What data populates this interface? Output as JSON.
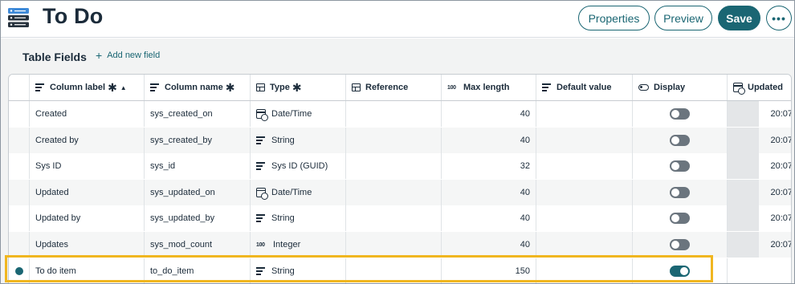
{
  "header": {
    "title": "To Do",
    "buttons": {
      "properties": "Properties",
      "preview": "Preview",
      "save": "Save",
      "more": "•••"
    }
  },
  "section": {
    "title": "Table Fields",
    "add_new": "Add new field"
  },
  "table": {
    "columns": {
      "label": "Column label",
      "name": "Column name",
      "type": "Type",
      "reference": "Reference",
      "max_length": "Max length",
      "default_value": "Default value",
      "display": "Display",
      "updated": "Updated"
    },
    "required_mark": "✱",
    "rows": [
      {
        "label": "Created",
        "name": "sys_created_on",
        "type": "Date/Time",
        "type_icon": "calendar-clock-icon",
        "max_length": "40",
        "display": false,
        "updated": "20:07"
      },
      {
        "label": "Created by",
        "name": "sys_created_by",
        "type": "String",
        "type_icon": "text-lines-icon",
        "max_length": "40",
        "display": false,
        "updated": "20:07"
      },
      {
        "label": "Sys ID",
        "name": "sys_id",
        "type": "Sys ID (GUID)",
        "type_icon": "text-lines-icon",
        "max_length": "32",
        "display": false,
        "updated": "20:07"
      },
      {
        "label": "Updated",
        "name": "sys_updated_on",
        "type": "Date/Time",
        "type_icon": "calendar-clock-icon",
        "max_length": "40",
        "display": false,
        "updated": "20:07"
      },
      {
        "label": "Updated by",
        "name": "sys_updated_by",
        "type": "String",
        "type_icon": "text-lines-icon",
        "max_length": "40",
        "display": false,
        "updated": "20:07"
      },
      {
        "label": "Updates",
        "name": "sys_mod_count",
        "type": "Integer",
        "type_icon": "number-icon",
        "max_length": "40",
        "display": false,
        "updated": "20:07"
      },
      {
        "label": "To do item",
        "name": "to_do_item",
        "type": "String",
        "type_icon": "text-lines-icon",
        "max_length": "150",
        "display": true,
        "updated": ""
      }
    ]
  },
  "colors": {
    "accent": "#1a6673",
    "highlight": "#f0b620"
  }
}
